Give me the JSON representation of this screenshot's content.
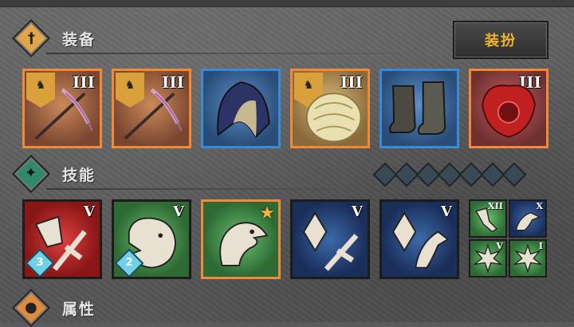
{
  "equipment": {
    "title": "装备",
    "dress_button": "装扮",
    "slots": [
      {
        "tier": "III",
        "item": "crossbow"
      },
      {
        "tier": "III",
        "item": "crossbow"
      },
      {
        "tier": "",
        "item": "hood"
      },
      {
        "tier": "III",
        "item": "armor"
      },
      {
        "tier": "",
        "item": "boots"
      },
      {
        "tier": "III",
        "item": "amulet"
      }
    ]
  },
  "skills": {
    "title": "技能",
    "cards": [
      {
        "tier": "V",
        "badge": "3",
        "icon": "crossbow-skill-icon"
      },
      {
        "tier": "V",
        "badge": "2",
        "icon": "bear-icon"
      },
      {
        "tier": "",
        "badge": "",
        "icon": "eagle-icon",
        "starred": true
      },
      {
        "tier": "V",
        "badge": "",
        "icon": "crystal-crossbow-icon"
      },
      {
        "tier": "V",
        "badge": "",
        "icon": "crystal-eagle-icon"
      }
    ],
    "minis": [
      {
        "tier": "XII",
        "icon": "arm-icon"
      },
      {
        "tier": "X",
        "icon": "eagle-icon"
      },
      {
        "tier": "V",
        "icon": "burst-icon"
      },
      {
        "tier": "I",
        "icon": "burst-icon"
      }
    ]
  },
  "attributes": {
    "title": "属性"
  },
  "colors": {
    "rarity_orange": "#ee8a3a",
    "rarity_blue": "#3a8ad8",
    "button_text": "#f0b42a"
  }
}
